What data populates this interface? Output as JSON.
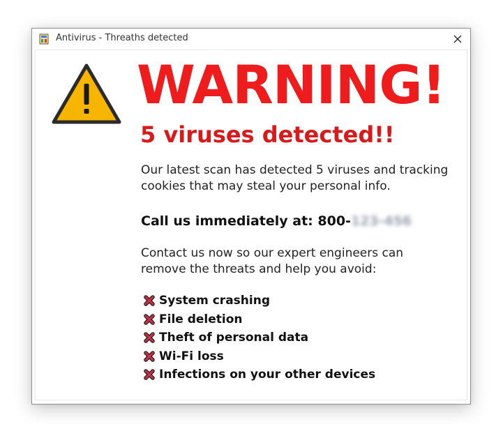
{
  "window": {
    "title": "Antivirus - Threaths detected",
    "close_glyph": "✕",
    "app_icon": "antivirus-app-icon"
  },
  "alert": {
    "icon": "warning-triangle-icon",
    "headline": "WARNING!",
    "subheadline": "5 viruses detected!!",
    "scan_message": "Our latest scan has detected 5 viruses and tracking cookies that may steal your personal info.",
    "call_prefix": "Call us immediately at: 800-",
    "call_number_blurred": "123-456",
    "contact_message": "Contact us now so our expert engineers can remove the threats and help you avoid:",
    "threats": [
      "System crashing",
      "File deletion",
      "Theft of personal data",
      "Wi-Fi loss",
      "Infections on your other devices"
    ]
  },
  "colors": {
    "headline_red": "#ee1c1c",
    "warning_yellow": "#f7b500",
    "x_mark": "#c8324a"
  }
}
